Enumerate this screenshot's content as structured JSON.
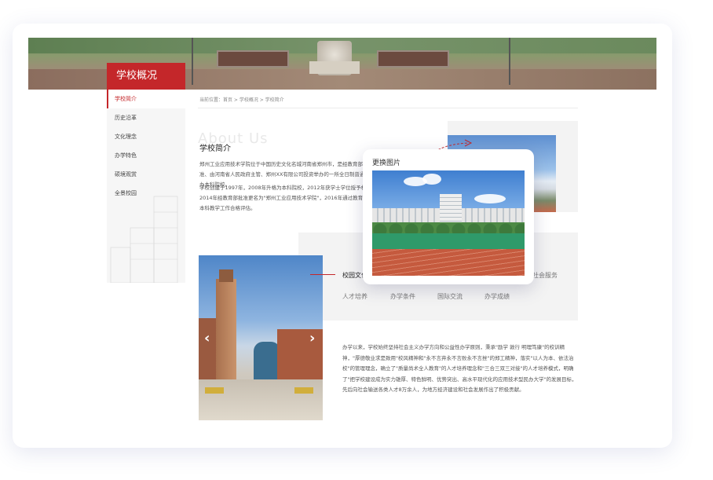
{
  "banner": {
    "title": "学校概况"
  },
  "sidebar": {
    "items": [
      {
        "label": "学校简介",
        "active": true
      },
      {
        "label": "历史沿革",
        "active": false
      },
      {
        "label": "文化理念",
        "active": false
      },
      {
        "label": "办学特色",
        "active": false
      },
      {
        "label": "硕境观赏",
        "active": false
      },
      {
        "label": "全景校园",
        "active": false
      }
    ]
  },
  "breadcrumb": "当前位置：首页 > 学校概况 > 学校简介",
  "intro": {
    "ghost_heading": "About Us",
    "title": "学校简介",
    "paragraphs": [
      "郑州工业应用技术学院位于中国历史文化名城河南省郑州市，是经教育部批准、由河南省人民政府主管、郑州XX有限公司投资举办的一所全日制普通民办本科院校。",
      "学校创建于1997年，2008年升格为本科院校，2012年获学士学位授予权，2014年经教育部批准更名为\"郑州工业应用技术学院\"，2016年通过教育部本科教学工作合格评估。"
    ]
  },
  "popover": {
    "title": "更换图片"
  },
  "campus": {
    "tabs_row1": [
      "校园文化",
      "社会服务"
    ],
    "tabs_row2": [
      "人才培养",
      "办学条件",
      "国际交流",
      "办学成绩"
    ],
    "prev_arrow": "‹",
    "next_arrow": "›",
    "paragraph": "办学以来，学校始终坚持社会主义办学方向和公益性办学原则，秉承\"励学 敦行 明理笃康\"的校训精神，\"厚德敬业求是致用\"校风精神和\"永不言弃永不言败永不言挫\"的郑工精神，落实\"以人为本、依法治校\"的管理理念，确立了\"质量尚术全人教育\"的人才培养理念和\"三合三双三对接\"的人才培养模式，明确了\"把学校建设成为实力雄厚、特色鲜明、优势突出、高水平现代化的应用技术型民办大学\"的发展目标，先后向社会输送各类人才8万余人，为地方经济建设和社会发展作出了积极贡献。"
  },
  "colors": {
    "accent": "#c4272a"
  }
}
